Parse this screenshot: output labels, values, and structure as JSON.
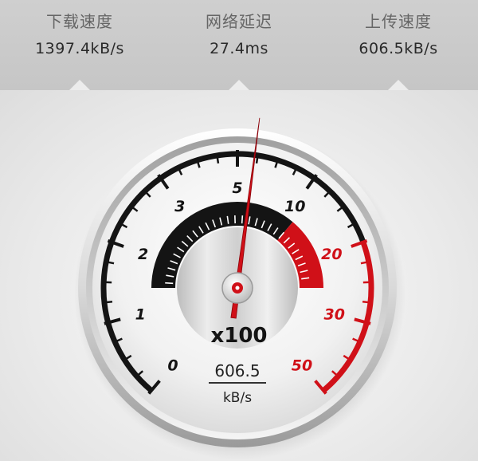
{
  "stats": {
    "download": {
      "label": "下载速度",
      "value": "1397.4kB/s"
    },
    "latency": {
      "label": "网络延迟",
      "value": "27.4ms"
    },
    "upload": {
      "label": "上传速度",
      "value": "606.5kB/s"
    }
  },
  "gauge": {
    "multiplier": "x100",
    "reading": "606.5",
    "unit": "kB/s",
    "needle_value": 6.065,
    "scale": [
      {
        "label": "0",
        "value": 0
      },
      {
        "label": "1",
        "value": 1
      },
      {
        "label": "2",
        "value": 2
      },
      {
        "label": "3",
        "value": 3
      },
      {
        "label": "5",
        "value": 5
      },
      {
        "label": "10",
        "value": 10
      },
      {
        "label": "20",
        "value": 20
      },
      {
        "label": "30",
        "value": 30
      },
      {
        "label": "50",
        "value": 50
      }
    ],
    "colors": {
      "normal": "#141414",
      "high": "#d01018",
      "needle": "#d01018"
    }
  }
}
